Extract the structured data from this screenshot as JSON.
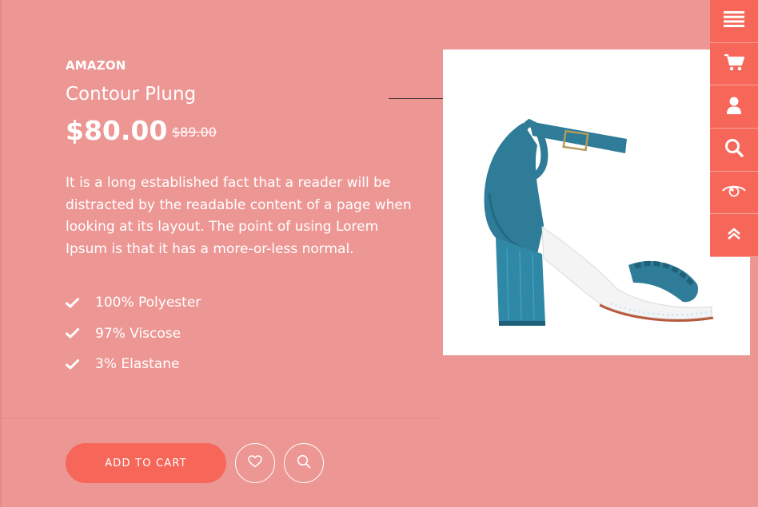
{
  "product": {
    "brand": "AMAZON",
    "title": "Contour Plung",
    "price": "$80.00",
    "old_price": "$89.00",
    "description": "It is a long established fact that a reader will be distracted by the readable content of a page when looking at its layout. The point of using Lorem Ipsum is that it has a more-or-less normal.",
    "features": [
      "100% Polyester",
      "97% Viscose",
      "3% Elastane"
    ]
  },
  "actions": {
    "add_to_cart": "ADD TO CART",
    "wishlist_icon": "heart-icon",
    "zoom_icon": "search-icon"
  },
  "side_menu": [
    {
      "icon": "menu-icon"
    },
    {
      "icon": "cart-icon"
    },
    {
      "icon": "user-icon"
    },
    {
      "icon": "search-icon"
    },
    {
      "icon": "eye-icon"
    },
    {
      "icon": "chevron-double-up-icon"
    }
  ],
  "colors": {
    "background": "#ED9795",
    "accent": "#F6675A",
    "text": "#FFFFFF",
    "shoe": "#2E7C98"
  }
}
